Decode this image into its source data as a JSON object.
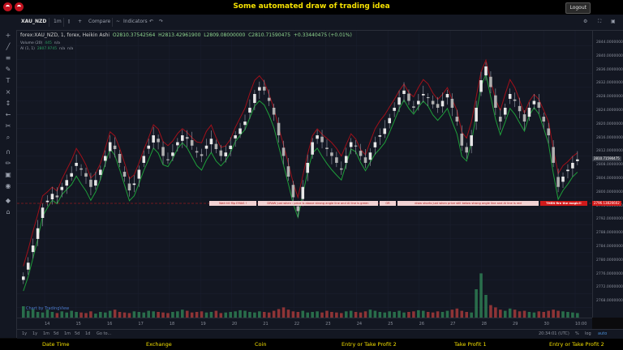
{
  "app": {
    "title": "Some automated draw of trading idea",
    "logout_label": "Logout"
  },
  "toolbar": {
    "symbol": "XAU_NZD",
    "interval": "1m",
    "compare_label": "Compare",
    "indicators_label": "Indicators"
  },
  "legend": {
    "symbol_line": "forex:XAU_NZD, 1, forex, Heikin Ashi",
    "open": "O2810.37542564",
    "high": "H2813.42961900",
    "low": "L2809.08000000",
    "close": "C2810.71590475",
    "change": "+0.33440475 (+0.01%)",
    "volume_label": "Volume (20)",
    "volume_value": "445",
    "volume_na": "n/a",
    "ai_label": "AI (1, 1)",
    "ai_value": "2807.9745",
    "ai_na1": "n/a",
    "ai_na2": "n/a"
  },
  "price_axis": {
    "labels": [
      "2844.00000000",
      "2840.00000000",
      "2836.00000000",
      "2832.00000000",
      "2828.00000000",
      "2824.00000000",
      "2820.00000000",
      "2816.00000000",
      "2812.00000000",
      "2808.00000000",
      "2804.00000000",
      "2800.00000000",
      "2796.00000000",
      "2792.00000000",
      "2788.00000000",
      "2784.00000000",
      "2780.00000000",
      "2776.00000000",
      "2772.00000000",
      "2768.00000000"
    ],
    "last_price": "2810.71590475",
    "red_price": "2796.13826602"
  },
  "time_axis": {
    "labels": [
      "14",
      "15",
      "16",
      "17",
      "18",
      "19",
      "20",
      "21",
      "22",
      "23",
      "24",
      "25",
      "26",
      "27",
      "28",
      "29",
      "30",
      "10:00"
    ]
  },
  "bottom": {
    "ranges": [
      "1y",
      "1y",
      "1m",
      "5d",
      "1m",
      "5d",
      "1d"
    ],
    "goto": "Go to...",
    "clock": "20:34:01 (UTC)",
    "pct": "%",
    "log": "log",
    "auto": "auto"
  },
  "banners": [
    "Wait till flip EMAS !",
    "DRAW just when : price is above strong angle line and AI line is green",
    "OR",
    "draw shorts just when price still below strong angle line and AI line is red",
    "THEN fire the magic!!"
  ],
  "watermark": "Chart by TradingView",
  "footer": [
    "Date Time",
    "Exchange",
    "Coin",
    "Entry or Take Profit 2",
    "Take Profit 1",
    "Entry or Take Profit 2"
  ],
  "colors": {
    "bull": "#e8e8e8",
    "bear": "#b0b0b0",
    "ema_red": "#a0101a",
    "ema_green": "#1e9e3a",
    "vol_green": "#2e7d52",
    "vol_red": "#a43a3a",
    "accent": "#f5e100"
  },
  "chart_data": {
    "type": "candlestick",
    "price_range": [
      2766,
      2846
    ],
    "volume_range": [
      0,
      100
    ],
    "closes": [
      2777,
      2781,
      2786,
      2791,
      2797,
      2799,
      2801,
      2800,
      2803,
      2805,
      2807,
      2810,
      2808,
      2806,
      2803,
      2805,
      2808,
      2812,
      2816,
      2814,
      2810,
      2806,
      2802,
      2804,
      2808,
      2812,
      2815,
      2818,
      2816,
      2812,
      2811,
      2813,
      2816,
      2818,
      2817,
      2815,
      2813,
      2812,
      2815,
      2817,
      2814,
      2812,
      2813,
      2815,
      2818,
      2820,
      2822,
      2826,
      2830,
      2832,
      2831,
      2828,
      2824,
      2818,
      2812,
      2806,
      2800,
      2796,
      2803,
      2810,
      2816,
      2818,
      2816,
      2814,
      2812,
      2810,
      2808,
      2812,
      2816,
      2815,
      2812,
      2810,
      2813,
      2816,
      2818,
      2820,
      2823,
      2826,
      2829,
      2831,
      2828,
      2826,
      2828,
      2830,
      2829,
      2827,
      2826,
      2828,
      2830,
      2826,
      2822,
      2815,
      2813,
      2818,
      2826,
      2834,
      2838,
      2832,
      2826,
      2822,
      2826,
      2830,
      2828,
      2825,
      2822,
      2826,
      2828,
      2826,
      2822,
      2818,
      2810,
      2803,
      2806,
      2808,
      2810,
      2811
    ],
    "volumes": [
      20,
      12,
      15,
      10,
      9,
      14,
      10,
      8,
      11,
      9,
      12,
      10,
      9,
      8,
      11,
      7,
      10,
      9,
      12,
      14,
      10,
      9,
      8,
      11,
      10,
      9,
      12,
      11,
      10,
      9,
      8,
      10,
      11,
      14,
      12,
      9,
      10,
      11,
      9,
      10,
      12,
      8,
      9,
      10,
      11,
      13,
      12,
      10,
      9,
      11,
      10,
      9,
      12,
      15,
      18,
      14,
      11,
      10,
      12,
      9,
      10,
      11,
      9,
      12,
      10,
      9,
      8,
      11,
      12,
      10,
      9,
      11,
      14,
      12,
      10,
      9,
      11,
      10,
      12,
      9,
      10,
      11,
      13,
      12,
      10,
      9,
      11,
      10,
      12,
      14,
      16,
      12,
      10,
      9,
      50,
      78,
      40,
      22,
      18,
      14,
      12,
      16,
      14,
      11,
      12,
      10,
      9,
      11,
      10,
      12,
      14,
      12,
      11,
      10,
      9,
      8
    ]
  }
}
